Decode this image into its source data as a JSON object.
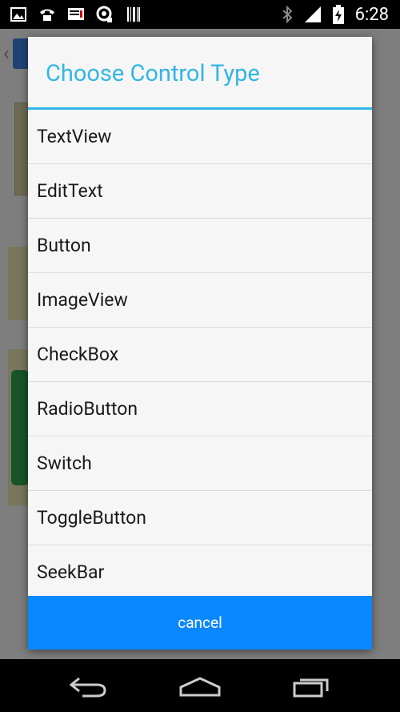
{
  "status_bar": {
    "time": "6:28",
    "left_icons": [
      "image-icon",
      "phone-icon",
      "tv-icon",
      "settings-icon",
      "barcode-icon"
    ],
    "right_icons": [
      "bluetooth-icon",
      "signal-icon",
      "battery-charging-icon"
    ]
  },
  "dialog": {
    "title": "Choose Control Type",
    "options": [
      {
        "label": "TextView"
      },
      {
        "label": "EditText"
      },
      {
        "label": "Button"
      },
      {
        "label": "ImageView"
      },
      {
        "label": "CheckBox"
      },
      {
        "label": "RadioButton"
      },
      {
        "label": "Switch"
      },
      {
        "label": "ToggleButton"
      },
      {
        "label": "SeekBar"
      }
    ],
    "cancel_label": "cancel"
  },
  "navigation_bar": {
    "buttons": [
      "back-icon",
      "home-icon",
      "recent-apps-icon"
    ]
  },
  "colors": {
    "accent": "#33b5e5",
    "cancel_button": "#0a88ff",
    "dialog_background": "#f6f6f6"
  }
}
